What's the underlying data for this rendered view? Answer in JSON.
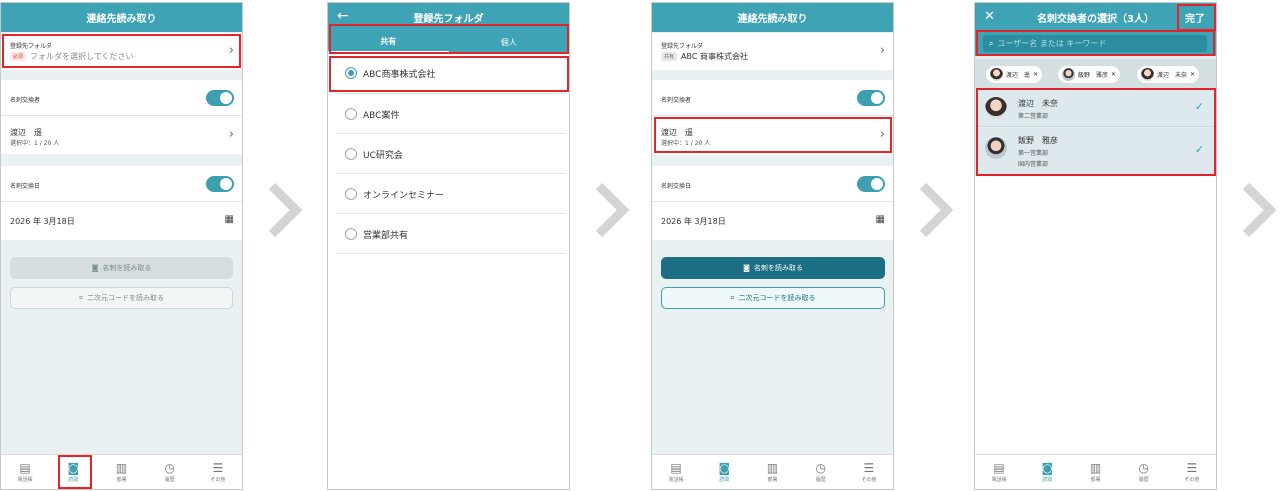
{
  "screen1": {
    "title": "連絡先読み取り",
    "folder_label": "登録先フォルダ",
    "required_badge": "必須",
    "folder_placeholder": "フォルダを選択してください",
    "exchanger_label": "名刺交換者",
    "exchanger_name": "渡辺　遥",
    "exchanger_count": "選択中：1 / 20 人",
    "date_label": "名刺交換日",
    "date_value": "2026 年 3月18日",
    "scan_card": "名刺を読み取る",
    "scan_qr": "二次元コードを読み取る"
  },
  "screen2": {
    "title": "登録先フォルダ",
    "tabs": [
      "共有",
      "個人"
    ],
    "folders": [
      "ABC商事株式会社",
      "ABC案件",
      "UC研究会",
      "オンラインセミナー",
      "営業部共有"
    ]
  },
  "screen3": {
    "title": "連絡先読み取り",
    "folder_label": "登録先フォルダ",
    "shared_badge": "共有",
    "folder_value": "ABC 商事株式会社",
    "exchanger_label": "名刺交換者",
    "exchanger_name": "渡辺　遥",
    "exchanger_count": "選択中：1 / 20 人",
    "date_label": "名刺交換日",
    "date_value": "2026 年 3月18日",
    "scan_card": "名刺を読み取る",
    "scan_qr": "二次元コードを読み取る"
  },
  "screen4": {
    "title": "名刺交換者の選択（3人）",
    "done": "完了",
    "search_placeholder": "ユーザー名 または キーワード",
    "chips": [
      "渡辺　遥",
      "飯野　雅彦",
      "渡辺　未奈"
    ],
    "users": [
      {
        "name": "渡辺　未奈",
        "dept1": "第二営業部",
        "dept2": ""
      },
      {
        "name": "飯野　雅彦",
        "dept1": "第一営業部",
        "dept2": "国内営業部"
      }
    ]
  },
  "tabbar": [
    "電話帳",
    "読取",
    "部署",
    "履歴",
    "その他"
  ],
  "colors": {
    "header": "#3ea3b5",
    "accent": "#3d9fb0",
    "highlight": "#e0262b",
    "primary_button": "#1c6f82"
  },
  "icons": {
    "chevron": "›",
    "camera": "camera-icon",
    "qr": "qr-icon",
    "calendar": "calendar-icon",
    "check": "✓"
  }
}
